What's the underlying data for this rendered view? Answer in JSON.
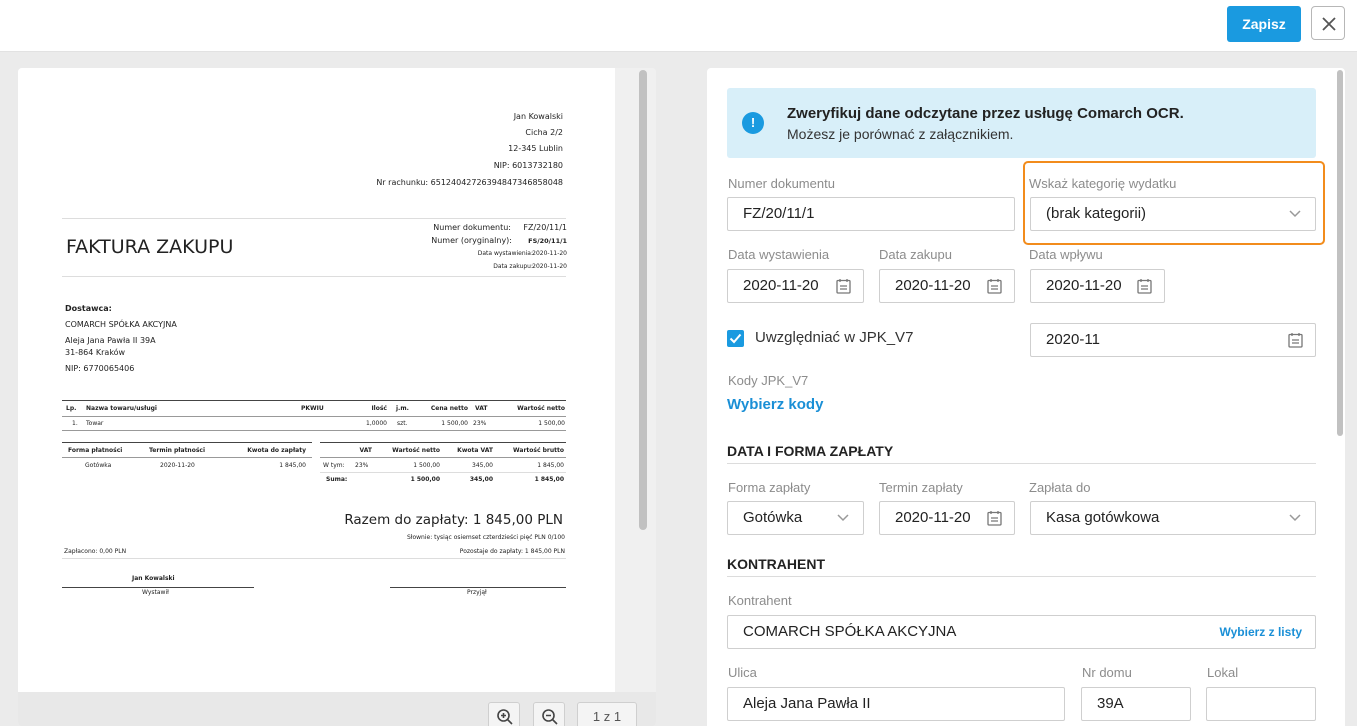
{
  "toolbar": {
    "save_label": "Zapisz"
  },
  "invoice": {
    "recipient": [
      "Jan Kowalski",
      "Cicha 2/2",
      "12-345 Lublin",
      "NIP: 6013732180",
      "Nr rachunku: 65124042726394847346858048"
    ],
    "title": "FAKTURA ZAKUPU",
    "meta": [
      {
        "label": "Numer dokumentu:",
        "value": "FZ/20/11/1"
      },
      {
        "label": "Numer (oryginalny):",
        "value": "FS/20/11/1"
      },
      {
        "label": "Data wystawienia:",
        "value": "2020-11-20"
      },
      {
        "label": "Data zakupu:",
        "value": "2020-11-20"
      }
    ],
    "supplier_label": "Dostawca:",
    "supplier": [
      "COMARCH SPÓŁKA AKCYJNA",
      "Aleja Jana Pawła II 39A",
      "31-864 Kraków",
      "NIP: 6770065406"
    ],
    "items_header": [
      "Lp.",
      "Nazwa towaru/usługi",
      "PKWIU",
      "Ilość",
      "j.m.",
      "Cena netto",
      "VAT",
      "Wartość netto"
    ],
    "items": [
      [
        "1.",
        "Towar",
        "",
        "1,0000",
        "szt.",
        "1 500,00",
        "23%",
        "1 500,00"
      ]
    ],
    "payment_header": [
      "Forma płatności",
      "Termin płatności",
      "Kwota do zapłaty"
    ],
    "payment_row": [
      "Gotówka",
      "2020-11-20",
      "1 845,00"
    ],
    "vat_header": [
      "VAT",
      "Wartość netto",
      "Kwota VAT",
      "Wartość brutto"
    ],
    "vat_row": [
      "W tym:",
      "23%",
      "1 500,00",
      "345,00",
      "1 845,00"
    ],
    "vat_sum": [
      "Suma:",
      "1 500,00",
      "345,00",
      "1 845,00"
    ],
    "total": "Razem do zapłaty: 1 845,00 PLN",
    "in_words": "Słownie: tysiąc osiemset czterdzieści pięć PLN 0/100",
    "paid": "Zapłacono: 0,00 PLN",
    "remaining": "Pozostaje do zapłaty: 1 845,00 PLN",
    "issuer_name": "Jan Kowalski",
    "issuer_label": "Wystawił",
    "receiver_label": "Przyjął"
  },
  "viewer": {
    "page_indicator": "1 z 1"
  },
  "info": {
    "title": "Zweryfikuj dane odczytane przez usługę Comarch OCR.",
    "subtitle": "Możesz je porównać z załącznikiem.",
    "icon": "!"
  },
  "form": {
    "doc_number": {
      "label": "Numer dokumentu",
      "value": "FZ/20/11/1"
    },
    "category": {
      "label": "Wskaż kategorię wydatku",
      "value": "(brak kategorii)"
    },
    "issue_date": {
      "label": "Data wystawienia",
      "value": "2020-11-20"
    },
    "purchase_date": {
      "label": "Data zakupu",
      "value": "2020-11-20"
    },
    "receipt_date": {
      "label": "Data wpływu",
      "value": "2020-11-20"
    },
    "jpk": {
      "label": "Uwzględniać w JPK_V7",
      "period": "2020-11",
      "checked": true
    },
    "jpk_codes": {
      "label": "Kody JPK_V7",
      "link": "Wybierz kody"
    },
    "payment_section": "DATA I FORMA ZAPŁATY",
    "payment_form": {
      "label": "Forma zapłaty",
      "value": "Gotówka"
    },
    "payment_due": {
      "label": "Termin zapłaty",
      "value": "2020-11-20"
    },
    "payment_to": {
      "label": "Zapłata do",
      "value": "Kasa gotówkowa"
    },
    "contractor_section": "KONTRAHENT",
    "contractor": {
      "label": "Kontrahent",
      "value": "COMARCH SPÓŁKA AKCYJNA",
      "pick": "Wybierz z listy"
    },
    "street": {
      "label": "Ulica",
      "value": "Aleja Jana Pawła II"
    },
    "house": {
      "label": "Nr domu",
      "value": "39A"
    },
    "flat": {
      "label": "Lokal",
      "value": ""
    }
  },
  "colors": {
    "accent": "#1a9ae0",
    "highlight": "#f28c1c",
    "info_bg": "#d8eff9"
  }
}
